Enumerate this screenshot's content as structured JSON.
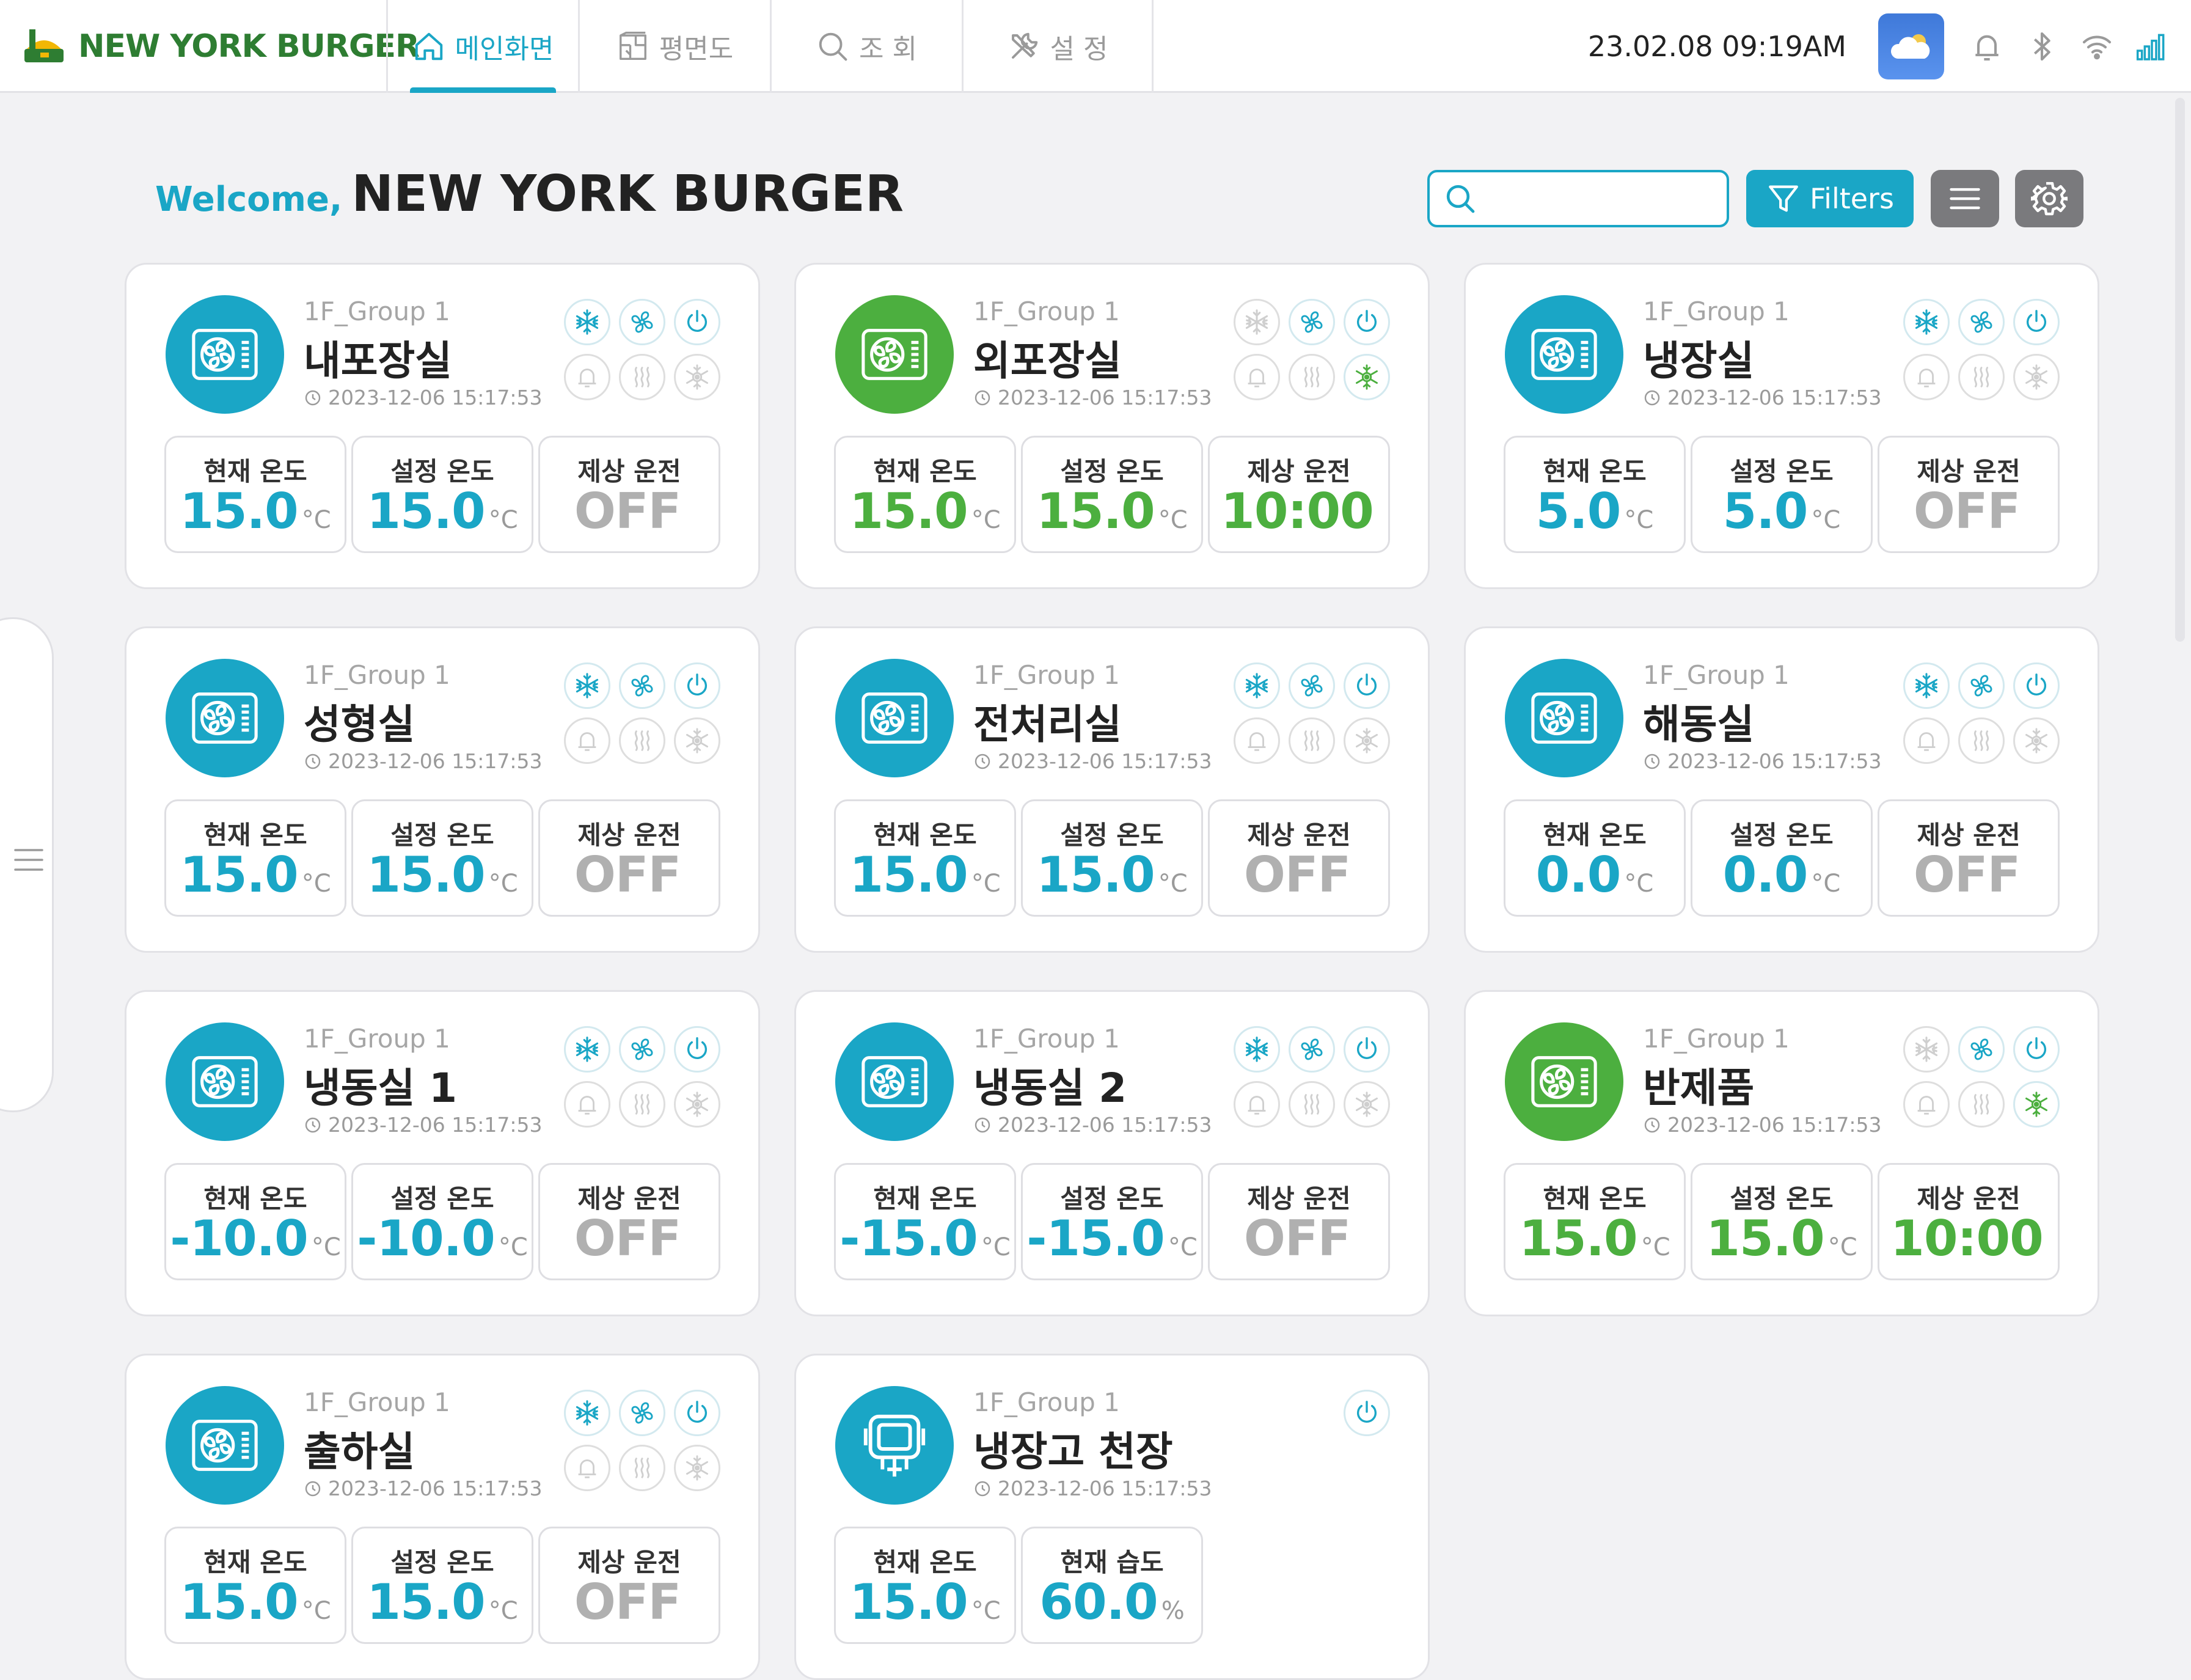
{
  "brand": {
    "name": "NEW YORK BURGER"
  },
  "nav": {
    "tabs": [
      {
        "label": "메인화면",
        "icon": "home-icon",
        "active": true
      },
      {
        "label": "평면도",
        "icon": "floorplan-icon",
        "active": false
      },
      {
        "label": "조 회",
        "icon": "search-icon",
        "active": false
      },
      {
        "label": "설 정",
        "icon": "tools-icon",
        "active": false
      }
    ]
  },
  "status": {
    "datetime": "23.02.08  09:19AM",
    "icons": [
      "weather-cloud-icon",
      "bell-icon",
      "bluetooth-icon",
      "wifi-icon",
      "signal-icon"
    ]
  },
  "header": {
    "welcome_lead": "Welcome,",
    "welcome_name": "NEW YORK BURGER",
    "search_placeholder": "",
    "filters_label": "Filters"
  },
  "colors": {
    "accent": "#1aa6c6",
    "green": "#4caf3f",
    "off": "#b0b0b0"
  },
  "cards": [
    {
      "group": "1F_Group 1",
      "name": "내포장실",
      "time": "2023-12-06 15:17:53",
      "status": "teal",
      "icons": {
        "cool": true,
        "fan": true,
        "power": true,
        "alarm": false,
        "heat": false,
        "defrost": false
      },
      "stats": [
        {
          "label": "현재 온도",
          "value": "15.0",
          "unit": "°C",
          "tone": "teal"
        },
        {
          "label": "설정 온도",
          "value": "15.0",
          "unit": "°C",
          "tone": "teal"
        },
        {
          "label": "제상 운전",
          "value": "OFF",
          "unit": "",
          "tone": "off"
        }
      ]
    },
    {
      "group": "1F_Group 1",
      "name": "외포장실",
      "time": "2023-12-06 15:17:53",
      "status": "green",
      "icons": {
        "cool": false,
        "fan": true,
        "power": true,
        "alarm": false,
        "heat": false,
        "defrost": true
      },
      "stats": [
        {
          "label": "현재 온도",
          "value": "15.0",
          "unit": "°C",
          "tone": "green"
        },
        {
          "label": "설정 온도",
          "value": "15.0",
          "unit": "°C",
          "tone": "green"
        },
        {
          "label": "제상 운전",
          "value": "10:00",
          "unit": "",
          "tone": "green"
        }
      ]
    },
    {
      "group": "1F_Group 1",
      "name": "냉장실",
      "time": "2023-12-06 15:17:53",
      "status": "teal",
      "icons": {
        "cool": true,
        "fan": true,
        "power": true,
        "alarm": false,
        "heat": false,
        "defrost": false
      },
      "stats": [
        {
          "label": "현재 온도",
          "value": "5.0",
          "unit": "°C",
          "tone": "teal"
        },
        {
          "label": "설정 온도",
          "value": "5.0",
          "unit": "°C",
          "tone": "teal"
        },
        {
          "label": "제상 운전",
          "value": "OFF",
          "unit": "",
          "tone": "off"
        }
      ]
    },
    {
      "group": "1F_Group 1",
      "name": "성형실",
      "time": "2023-12-06 15:17:53",
      "status": "teal",
      "icons": {
        "cool": true,
        "fan": true,
        "power": true,
        "alarm": false,
        "heat": false,
        "defrost": false
      },
      "stats": [
        {
          "label": "현재 온도",
          "value": "15.0",
          "unit": "°C",
          "tone": "teal"
        },
        {
          "label": "설정 온도",
          "value": "15.0",
          "unit": "°C",
          "tone": "teal"
        },
        {
          "label": "제상 운전",
          "value": "OFF",
          "unit": "",
          "tone": "off"
        }
      ]
    },
    {
      "group": "1F_Group 1",
      "name": "전처리실",
      "time": "2023-12-06 15:17:53",
      "status": "teal",
      "icons": {
        "cool": true,
        "fan": true,
        "power": true,
        "alarm": false,
        "heat": false,
        "defrost": false
      },
      "stats": [
        {
          "label": "현재 온도",
          "value": "15.0",
          "unit": "°C",
          "tone": "teal"
        },
        {
          "label": "설정 온도",
          "value": "15.0",
          "unit": "°C",
          "tone": "teal"
        },
        {
          "label": "제상 운전",
          "value": "OFF",
          "unit": "",
          "tone": "off"
        }
      ]
    },
    {
      "group": "1F_Group 1",
      "name": "해동실",
      "time": "2023-12-06 15:17:53",
      "status": "teal",
      "icons": {
        "cool": true,
        "fan": true,
        "power": true,
        "alarm": false,
        "heat": false,
        "defrost": false
      },
      "stats": [
        {
          "label": "현재 온도",
          "value": "0.0",
          "unit": "°C",
          "tone": "teal"
        },
        {
          "label": "설정 온도",
          "value": "0.0",
          "unit": "°C",
          "tone": "teal"
        },
        {
          "label": "제상 운전",
          "value": "OFF",
          "unit": "",
          "tone": "off"
        }
      ]
    },
    {
      "group": "1F_Group 1",
      "name": "냉동실 1",
      "time": "2023-12-06 15:17:53",
      "status": "teal",
      "icons": {
        "cool": true,
        "fan": true,
        "power": true,
        "alarm": false,
        "heat": false,
        "defrost": false
      },
      "stats": [
        {
          "label": "현재 온도",
          "value": "-10.0",
          "unit": "°C",
          "tone": "teal"
        },
        {
          "label": "설정 온도",
          "value": "-10.0",
          "unit": "°C",
          "tone": "teal"
        },
        {
          "label": "제상 운전",
          "value": "OFF",
          "unit": "",
          "tone": "off"
        }
      ]
    },
    {
      "group": "1F_Group 1",
      "name": "냉동실 2",
      "time": "2023-12-06 15:17:53",
      "status": "teal",
      "icons": {
        "cool": true,
        "fan": true,
        "power": true,
        "alarm": false,
        "heat": false,
        "defrost": false
      },
      "stats": [
        {
          "label": "현재 온도",
          "value": "-15.0",
          "unit": "°C",
          "tone": "teal"
        },
        {
          "label": "설정 온도",
          "value": "-15.0",
          "unit": "°C",
          "tone": "teal"
        },
        {
          "label": "제상 운전",
          "value": "OFF",
          "unit": "",
          "tone": "off"
        }
      ]
    },
    {
      "group": "1F_Group 1",
      "name": "반제품",
      "time": "2023-12-06 15:17:53",
      "status": "green",
      "icons": {
        "cool": false,
        "fan": true,
        "power": true,
        "alarm": false,
        "heat": false,
        "defrost": true
      },
      "stats": [
        {
          "label": "현재 온도",
          "value": "15.0",
          "unit": "°C",
          "tone": "green"
        },
        {
          "label": "설정 온도",
          "value": "15.0",
          "unit": "°C",
          "tone": "green"
        },
        {
          "label": "제상 운전",
          "value": "10:00",
          "unit": "",
          "tone": "green"
        }
      ]
    },
    {
      "group": "1F_Group 1",
      "name": "출하실",
      "time": "2023-12-06 15:17:53",
      "status": "teal",
      "icons": {
        "cool": true,
        "fan": true,
        "power": true,
        "alarm": false,
        "heat": false,
        "defrost": false
      },
      "stats": [
        {
          "label": "현재 온도",
          "value": "15.0",
          "unit": "°C",
          "tone": "teal"
        },
        {
          "label": "설정 온도",
          "value": "15.0",
          "unit": "°C",
          "tone": "teal"
        },
        {
          "label": "제상 운전",
          "value": "OFF",
          "unit": "",
          "tone": "off"
        }
      ]
    },
    {
      "group": "1F_Group 1",
      "name": "냉장고 천장",
      "time": "2023-12-06 15:17:53",
      "status": "teal",
      "sensor": true,
      "icons": {
        "power": true
      },
      "stats": [
        {
          "label": "현재 온도",
          "value": "15.0",
          "unit": "°C",
          "tone": "teal"
        },
        {
          "label": "현재 습도",
          "value": "60.0",
          "unit": "%",
          "tone": "teal"
        }
      ]
    }
  ]
}
